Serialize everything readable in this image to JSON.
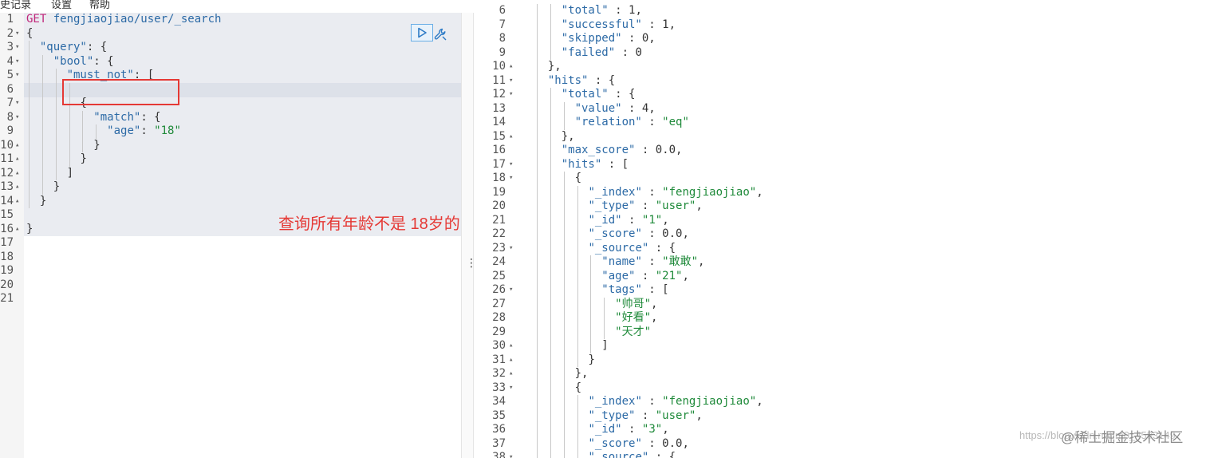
{
  "menu": [
    "史记录",
    "设置",
    "帮助"
  ],
  "request": {
    "method": "GET",
    "path": "fengjiaojiao/user/_search",
    "lines": [
      {
        "n": "1",
        "fold": "",
        "indent": 0,
        "parts": []
      },
      {
        "n": "2",
        "fold": "▾",
        "indent": 0,
        "parts": [
          [
            "n",
            "{"
          ]
        ]
      },
      {
        "n": "3",
        "fold": "▾",
        "indent": 2,
        "parts": [
          [
            "k",
            "\"query\""
          ],
          [
            "n",
            ": {"
          ]
        ]
      },
      {
        "n": "4",
        "fold": "▾",
        "indent": 4,
        "parts": [
          [
            "k",
            "\"bool\""
          ],
          [
            "n",
            ": {"
          ]
        ]
      },
      {
        "n": "5",
        "fold": "▾",
        "indent": 6,
        "parts": [
          [
            "k",
            "\"must_not\""
          ],
          [
            "n",
            ": ["
          ]
        ]
      },
      {
        "n": "6",
        "fold": "",
        "indent": 0,
        "parts": []
      },
      {
        "n": "7",
        "fold": "▾",
        "indent": 8,
        "parts": [
          [
            "n",
            "{"
          ]
        ]
      },
      {
        "n": "8",
        "fold": "▾",
        "indent": 10,
        "parts": [
          [
            "k",
            "\"match\""
          ],
          [
            "n",
            ": {"
          ]
        ]
      },
      {
        "n": "9",
        "fold": "",
        "indent": 12,
        "parts": [
          [
            "k",
            "\"age\""
          ],
          [
            "n",
            ": "
          ],
          [
            "s",
            "\"18\""
          ]
        ]
      },
      {
        "n": "10",
        "fold": "▴",
        "indent": 10,
        "parts": [
          [
            "n",
            "}"
          ]
        ]
      },
      {
        "n": "11",
        "fold": "▴",
        "indent": 8,
        "parts": [
          [
            "n",
            "}"
          ]
        ]
      },
      {
        "n": "12",
        "fold": "▴",
        "indent": 6,
        "parts": [
          [
            "n",
            "]"
          ]
        ]
      },
      {
        "n": "13",
        "fold": "▴",
        "indent": 4,
        "parts": [
          [
            "n",
            "}"
          ]
        ]
      },
      {
        "n": "14",
        "fold": "▴",
        "indent": 2,
        "parts": [
          [
            "n",
            "}"
          ]
        ]
      },
      {
        "n": "15",
        "fold": "",
        "indent": 0,
        "parts": []
      },
      {
        "n": "16",
        "fold": "▴",
        "indent": 0,
        "parts": [
          [
            "n",
            "}"
          ]
        ]
      },
      {
        "n": "17",
        "fold": "",
        "indent": 0,
        "parts": []
      },
      {
        "n": "18",
        "fold": "",
        "indent": 0,
        "parts": []
      },
      {
        "n": "19",
        "fold": "",
        "indent": 0,
        "parts": []
      },
      {
        "n": "20",
        "fold": "",
        "indent": 0,
        "parts": []
      },
      {
        "n": "21",
        "fold": "",
        "indent": 0,
        "parts": []
      }
    ]
  },
  "annotation": "查询所有年龄不是 18岁的",
  "response": {
    "lines": [
      {
        "n": "6",
        "fold": "",
        "indent": 4,
        "parts": [
          [
            "k",
            "\"total\""
          ],
          [
            "n",
            " : 1,"
          ]
        ]
      },
      {
        "n": "7",
        "fold": "",
        "indent": 4,
        "parts": [
          [
            "k",
            "\"successful\""
          ],
          [
            "n",
            " : 1,"
          ]
        ]
      },
      {
        "n": "8",
        "fold": "",
        "indent": 4,
        "parts": [
          [
            "k",
            "\"skipped\""
          ],
          [
            "n",
            " : 0,"
          ]
        ]
      },
      {
        "n": "9",
        "fold": "",
        "indent": 4,
        "parts": [
          [
            "k",
            "\"failed\""
          ],
          [
            "n",
            " : 0"
          ]
        ]
      },
      {
        "n": "10",
        "fold": "▴",
        "indent": 2,
        "parts": [
          [
            "n",
            "},"
          ]
        ]
      },
      {
        "n": "11",
        "fold": "▾",
        "indent": 2,
        "parts": [
          [
            "k",
            "\"hits\""
          ],
          [
            "n",
            " : {"
          ]
        ]
      },
      {
        "n": "12",
        "fold": "▾",
        "indent": 4,
        "parts": [
          [
            "k",
            "\"total\""
          ],
          [
            "n",
            " : {"
          ]
        ]
      },
      {
        "n": "13",
        "fold": "",
        "indent": 6,
        "parts": [
          [
            "k",
            "\"value\""
          ],
          [
            "n",
            " : 4,"
          ]
        ]
      },
      {
        "n": "14",
        "fold": "",
        "indent": 6,
        "parts": [
          [
            "k",
            "\"relation\""
          ],
          [
            "n",
            " : "
          ],
          [
            "s",
            "\"eq\""
          ]
        ]
      },
      {
        "n": "15",
        "fold": "▴",
        "indent": 4,
        "parts": [
          [
            "n",
            "},"
          ]
        ]
      },
      {
        "n": "16",
        "fold": "",
        "indent": 4,
        "parts": [
          [
            "k",
            "\"max_score\""
          ],
          [
            "n",
            " : 0.0,"
          ]
        ]
      },
      {
        "n": "17",
        "fold": "▾",
        "indent": 4,
        "parts": [
          [
            "k",
            "\"hits\""
          ],
          [
            "n",
            " : ["
          ]
        ]
      },
      {
        "n": "18",
        "fold": "▾",
        "indent": 6,
        "parts": [
          [
            "n",
            "{"
          ]
        ]
      },
      {
        "n": "19",
        "fold": "",
        "indent": 8,
        "parts": [
          [
            "k",
            "\"_index\""
          ],
          [
            "n",
            " : "
          ],
          [
            "s",
            "\"fengjiaojiao\""
          ],
          [
            "n",
            ","
          ]
        ]
      },
      {
        "n": "20",
        "fold": "",
        "indent": 8,
        "parts": [
          [
            "k",
            "\"_type\""
          ],
          [
            "n",
            " : "
          ],
          [
            "s",
            "\"user\""
          ],
          [
            "n",
            ","
          ]
        ]
      },
      {
        "n": "21",
        "fold": "",
        "indent": 8,
        "parts": [
          [
            "k",
            "\"_id\""
          ],
          [
            "n",
            " : "
          ],
          [
            "s",
            "\"1\""
          ],
          [
            "n",
            ","
          ]
        ]
      },
      {
        "n": "22",
        "fold": "",
        "indent": 8,
        "parts": [
          [
            "k",
            "\"_score\""
          ],
          [
            "n",
            " : 0.0,"
          ]
        ]
      },
      {
        "n": "23",
        "fold": "▾",
        "indent": 8,
        "parts": [
          [
            "k",
            "\"_source\""
          ],
          [
            "n",
            " : {"
          ]
        ]
      },
      {
        "n": "24",
        "fold": "",
        "indent": 10,
        "parts": [
          [
            "k",
            "\"name\""
          ],
          [
            "n",
            " : "
          ],
          [
            "s",
            "\"敢敢\""
          ],
          [
            "n",
            ","
          ]
        ]
      },
      {
        "n": "25",
        "fold": "",
        "indent": 10,
        "parts": [
          [
            "k",
            "\"age\""
          ],
          [
            "n",
            " : "
          ],
          [
            "s",
            "\"21\""
          ],
          [
            "n",
            ","
          ]
        ]
      },
      {
        "n": "26",
        "fold": "▾",
        "indent": 10,
        "parts": [
          [
            "k",
            "\"tags\""
          ],
          [
            "n",
            " : ["
          ]
        ]
      },
      {
        "n": "27",
        "fold": "",
        "indent": 12,
        "parts": [
          [
            "s",
            "\"帅哥\""
          ],
          [
            "n",
            ","
          ]
        ]
      },
      {
        "n": "28",
        "fold": "",
        "indent": 12,
        "parts": [
          [
            "s",
            "\"好看\""
          ],
          [
            "n",
            ","
          ]
        ]
      },
      {
        "n": "29",
        "fold": "",
        "indent": 12,
        "parts": [
          [
            "s",
            "\"天才\""
          ]
        ]
      },
      {
        "n": "30",
        "fold": "▴",
        "indent": 10,
        "parts": [
          [
            "n",
            "]"
          ]
        ]
      },
      {
        "n": "31",
        "fold": "▴",
        "indent": 8,
        "parts": [
          [
            "n",
            "}"
          ]
        ]
      },
      {
        "n": "32",
        "fold": "▴",
        "indent": 6,
        "parts": [
          [
            "n",
            "},"
          ]
        ]
      },
      {
        "n": "33",
        "fold": "▾",
        "indent": 6,
        "parts": [
          [
            "n",
            "{"
          ]
        ]
      },
      {
        "n": "34",
        "fold": "",
        "indent": 8,
        "parts": [
          [
            "k",
            "\"_index\""
          ],
          [
            "n",
            " : "
          ],
          [
            "s",
            "\"fengjiaojiao\""
          ],
          [
            "n",
            ","
          ]
        ]
      },
      {
        "n": "35",
        "fold": "",
        "indent": 8,
        "parts": [
          [
            "k",
            "\"_type\""
          ],
          [
            "n",
            " : "
          ],
          [
            "s",
            "\"user\""
          ],
          [
            "n",
            ","
          ]
        ]
      },
      {
        "n": "36",
        "fold": "",
        "indent": 8,
        "parts": [
          [
            "k",
            "\"_id\""
          ],
          [
            "n",
            " : "
          ],
          [
            "s",
            "\"3\""
          ],
          [
            "n",
            ","
          ]
        ]
      },
      {
        "n": "37",
        "fold": "",
        "indent": 8,
        "parts": [
          [
            "k",
            "\"_score\""
          ],
          [
            "n",
            " : 0.0,"
          ]
        ]
      },
      {
        "n": "38",
        "fold": "▾",
        "indent": 8,
        "parts": [
          [
            "k",
            "\"_source\""
          ],
          [
            "n",
            " : {"
          ]
        ]
      }
    ]
  },
  "watermark": "https://blog.csdn.net/m0_4593149",
  "watermark_brand": "@稀土掘金技术社区",
  "icons": {
    "run": "play-icon",
    "wrench": "wrench-icon"
  }
}
